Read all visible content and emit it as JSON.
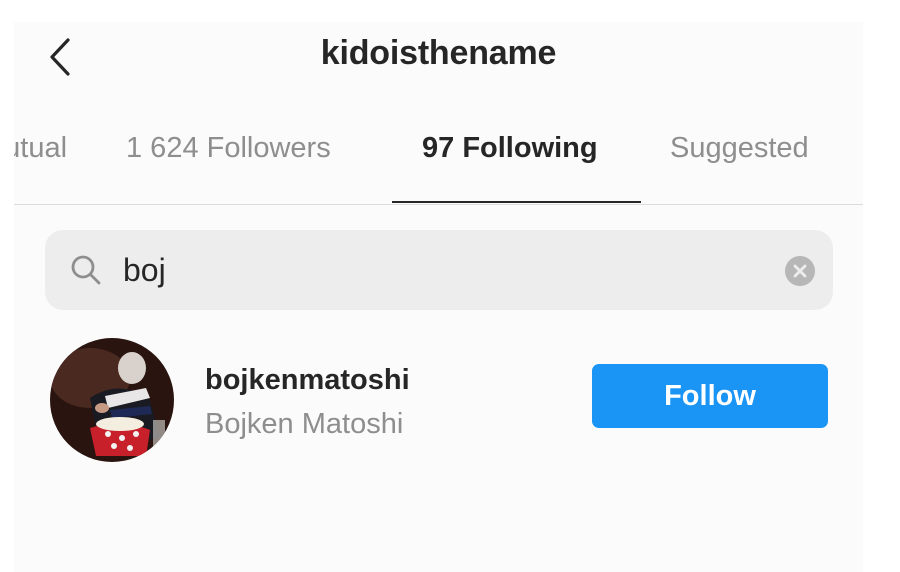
{
  "header": {
    "title": "kidoisthename",
    "back_icon": "chevron-left-icon"
  },
  "tabs": [
    {
      "label": "Mutual",
      "visible_text": "tual",
      "active": false
    },
    {
      "label": "1 624 Followers",
      "active": false
    },
    {
      "label": "97 Following",
      "active": true
    },
    {
      "label": "Suggested",
      "active": false
    }
  ],
  "search": {
    "value": "boj",
    "icon": "search-icon",
    "clear_icon": "clear-circle-icon"
  },
  "results": [
    {
      "username": "bojkenmatoshi",
      "full_name": "Bojken Matoshi",
      "button_label": "Follow"
    }
  ],
  "colors": {
    "accent": "#1a95f5",
    "text_primary": "#262626",
    "text_secondary": "#8e8e8e",
    "search_bg": "#ededed"
  }
}
